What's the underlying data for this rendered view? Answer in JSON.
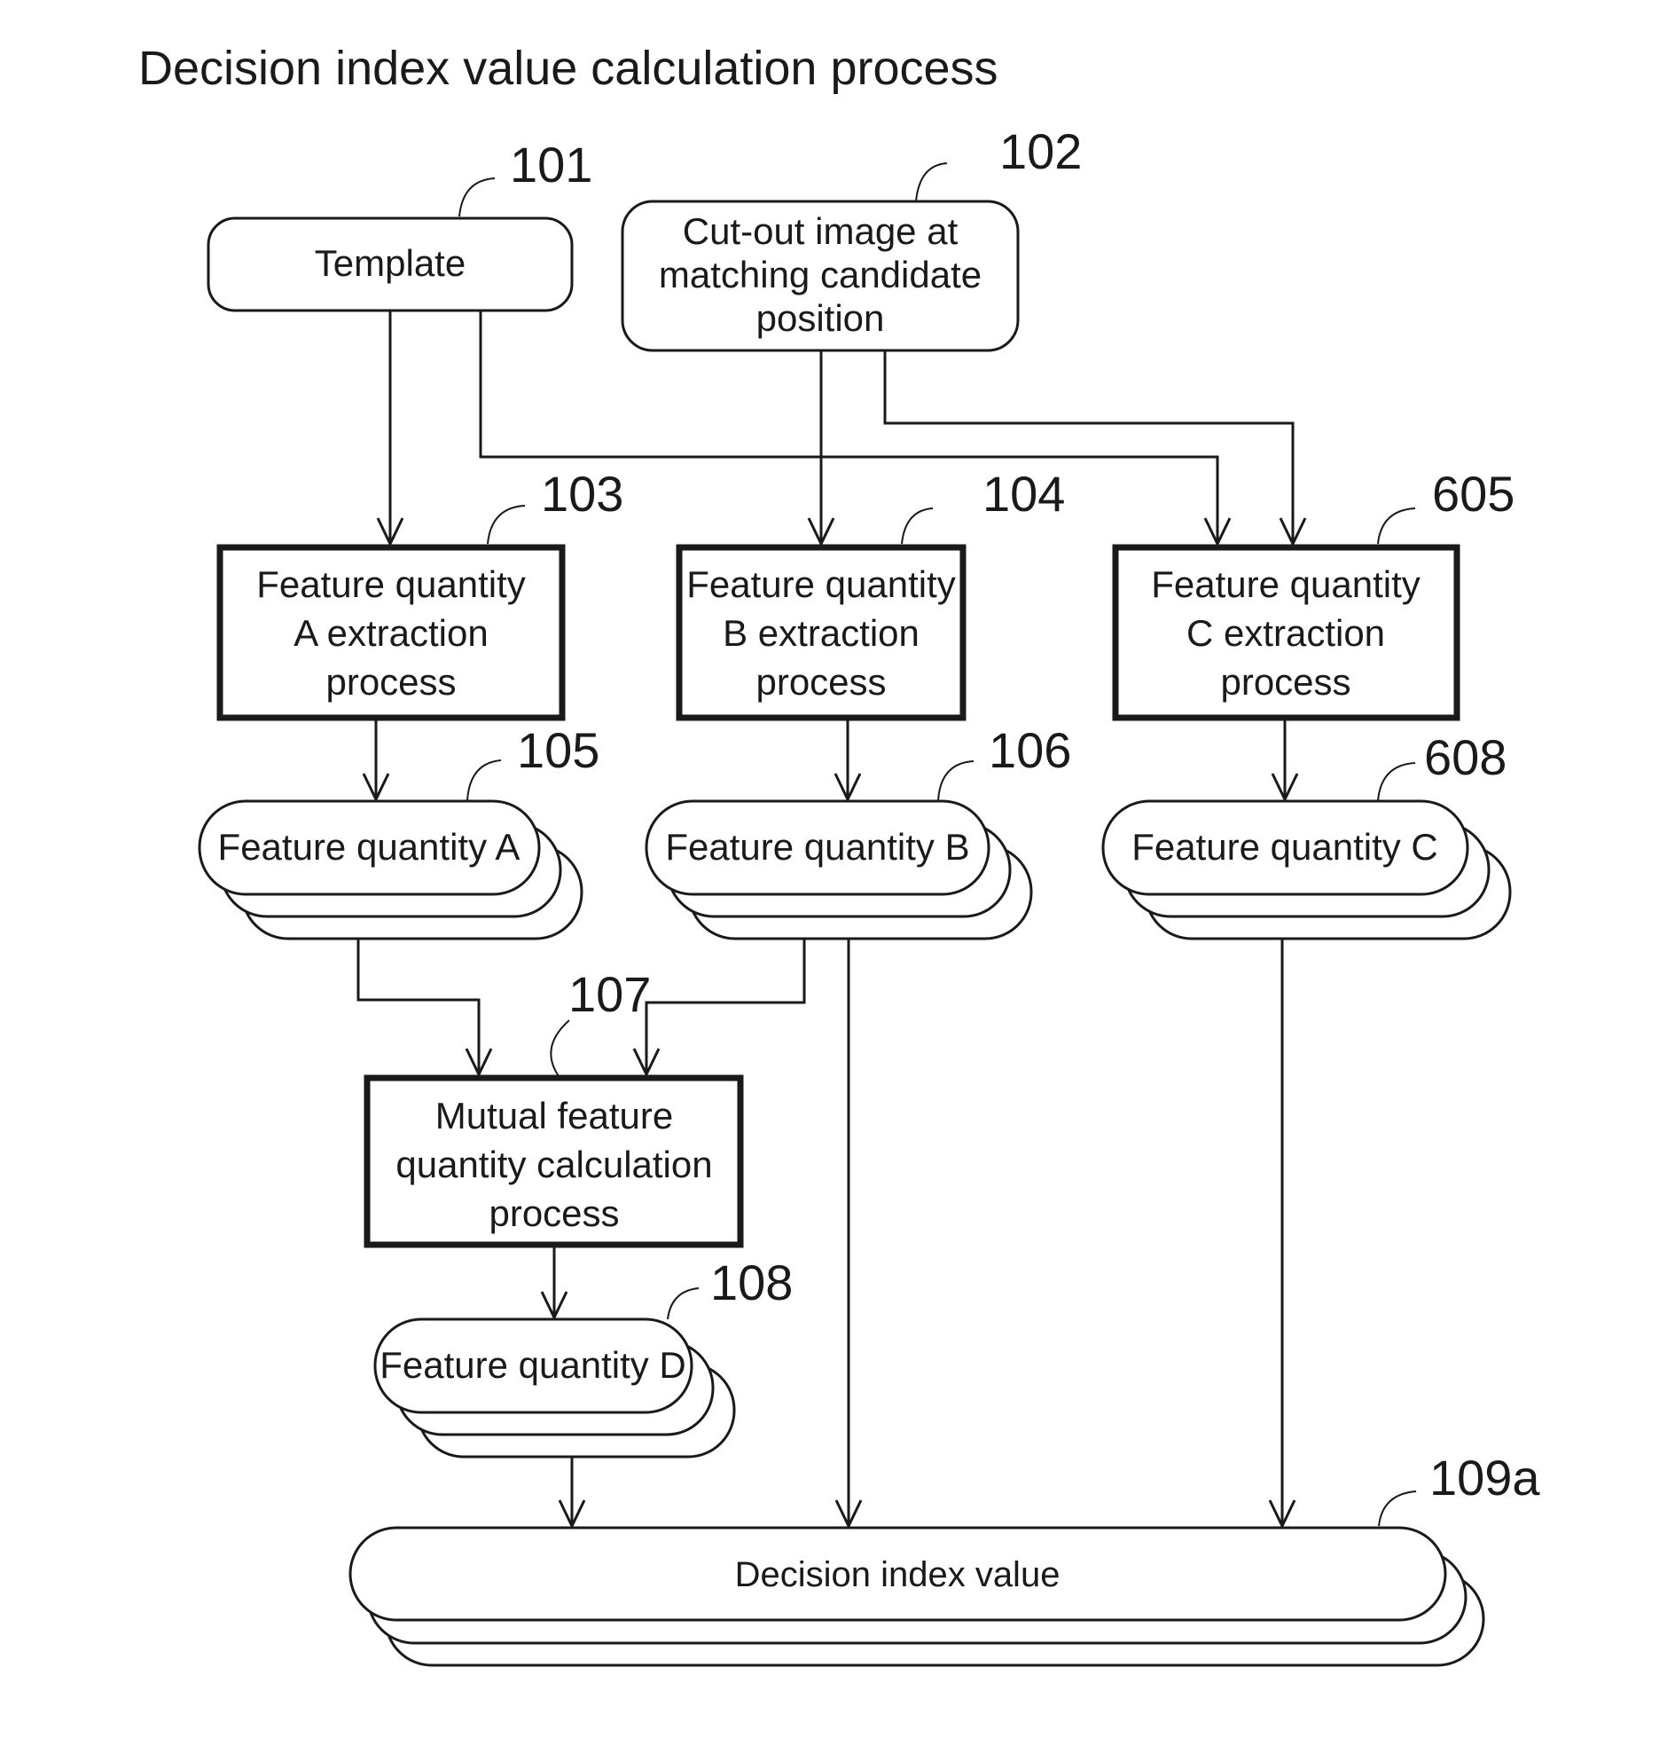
{
  "title": "Decision index value calculation process",
  "nodes": {
    "template": {
      "ref": "101",
      "lines": [
        "Template"
      ]
    },
    "cutout": {
      "ref": "102",
      "lines": [
        "Cut-out image at",
        "matching candidate",
        "position"
      ]
    },
    "extract_a": {
      "ref": "103",
      "lines": [
        "Feature quantity",
        "A extraction",
        "process"
      ]
    },
    "extract_b": {
      "ref": "104",
      "lines": [
        "Feature quantity",
        "B extraction",
        "process"
      ]
    },
    "extract_c": {
      "ref": "605",
      "lines": [
        "Feature quantity",
        "C extraction",
        "process"
      ]
    },
    "feature_a": {
      "ref": "105",
      "lines": [
        "Feature quantity A"
      ]
    },
    "feature_b": {
      "ref": "106",
      "lines": [
        "Feature quantity B"
      ]
    },
    "feature_c": {
      "ref": "608",
      "lines": [
        "Feature quantity C"
      ]
    },
    "mutual": {
      "ref": "107",
      "lines": [
        "Mutual feature",
        "quantity calculation",
        "process"
      ]
    },
    "feature_d": {
      "ref": "108",
      "lines": [
        "Feature quantity D"
      ]
    },
    "decision": {
      "ref": "109a",
      "lines": [
        "Decision index value"
      ]
    }
  },
  "edges": [
    {
      "from": "template",
      "to": "extract_a"
    },
    {
      "from": "template",
      "to": "extract_c"
    },
    {
      "from": "cutout",
      "to": "extract_b"
    },
    {
      "from": "cutout",
      "to": "extract_c"
    },
    {
      "from": "extract_a",
      "to": "feature_a"
    },
    {
      "from": "extract_b",
      "to": "feature_b"
    },
    {
      "from": "extract_c",
      "to": "feature_c"
    },
    {
      "from": "feature_a",
      "to": "mutual"
    },
    {
      "from": "feature_b",
      "to": "mutual"
    },
    {
      "from": "mutual",
      "to": "feature_d"
    },
    {
      "from": "feature_d",
      "to": "decision"
    },
    {
      "from": "feature_b",
      "to": "decision"
    },
    {
      "from": "feature_c",
      "to": "decision"
    }
  ]
}
